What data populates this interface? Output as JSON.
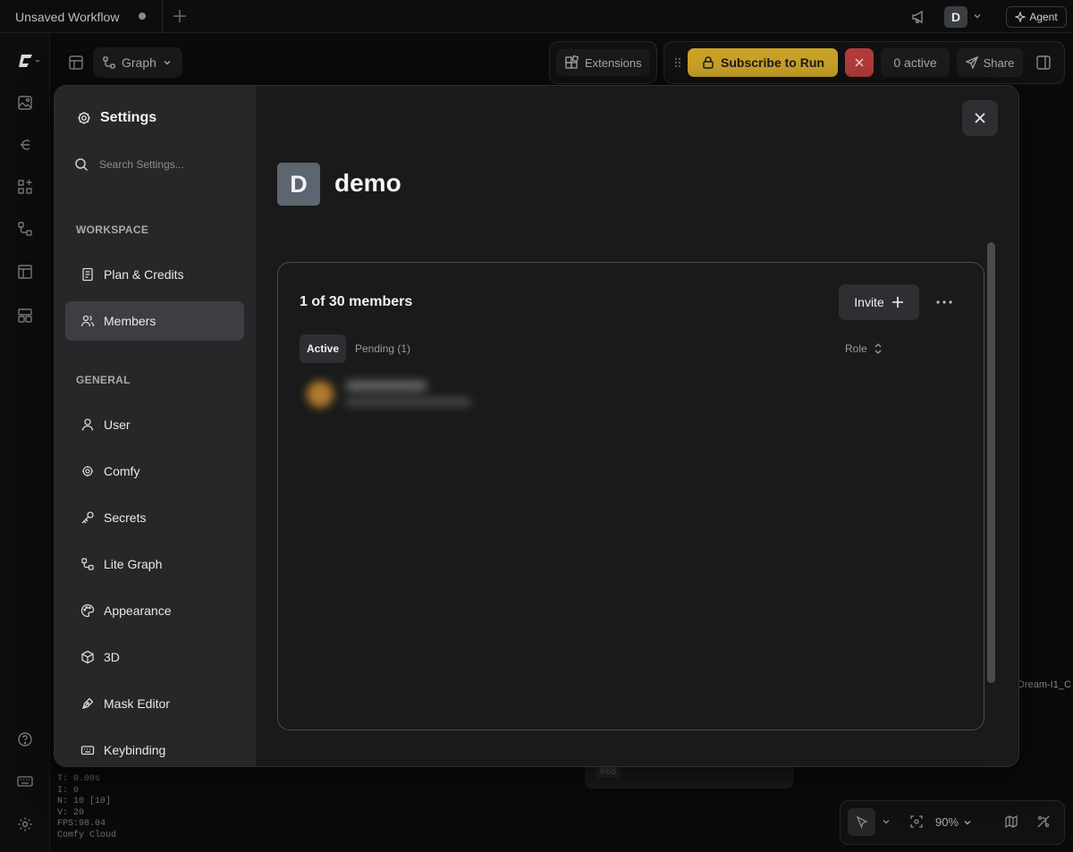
{
  "topbar": {
    "tab_title": "Unsaved Workflow",
    "add_tab_icon": "plus-icon",
    "announce_icon": "megaphone-icon",
    "avatar_letter": "D",
    "agent_label": "Agent"
  },
  "toolbar": {
    "graph_label": "Graph",
    "extensions_label": "Extensions",
    "subscribe_label": "Subscribe to Run",
    "active_label": "0 active",
    "share_label": "Share",
    "accent_color": "#c9a227",
    "stop_color": "#b23b3b"
  },
  "stats": {
    "lines": [
      "T: 0.00s",
      "I: 0",
      "N: 10 [10]",
      "V: 20",
      "FPS:98.04",
      "Comfy Cloud"
    ]
  },
  "canvas": {
    "node_id": "#68",
    "side_node_text": "Dream-I1_C"
  },
  "bottom_toolbar": {
    "zoom_label": "90%"
  },
  "settings": {
    "title": "Settings",
    "search_placeholder": "Search Settings...",
    "sections": [
      {
        "label": "WORKSPACE",
        "items": [
          {
            "label": "Plan & Credits",
            "icon": "document-icon"
          },
          {
            "label": "Members",
            "icon": "users-icon",
            "active": true
          }
        ]
      },
      {
        "label": "GENERAL",
        "items": [
          {
            "label": "User",
            "icon": "user-icon"
          },
          {
            "label": "Comfy",
            "icon": "gear-icon"
          },
          {
            "label": "Secrets",
            "icon": "key-icon"
          },
          {
            "label": "Lite Graph",
            "icon": "graph-icon"
          },
          {
            "label": "Appearance",
            "icon": "palette-icon"
          },
          {
            "label": "3D",
            "icon": "cube-icon"
          },
          {
            "label": "Mask Editor",
            "icon": "pen-icon"
          },
          {
            "label": "Keybinding",
            "icon": "keyboard-icon"
          }
        ]
      }
    ]
  },
  "workspace": {
    "avatar_letter": "D",
    "name": "demo",
    "avatar_color": "#5d6670"
  },
  "members": {
    "count_label": "1 of 30 members",
    "invite_label": "Invite",
    "tabs": {
      "active": "Active",
      "pending": "Pending (1)"
    },
    "role_label": "Role"
  }
}
